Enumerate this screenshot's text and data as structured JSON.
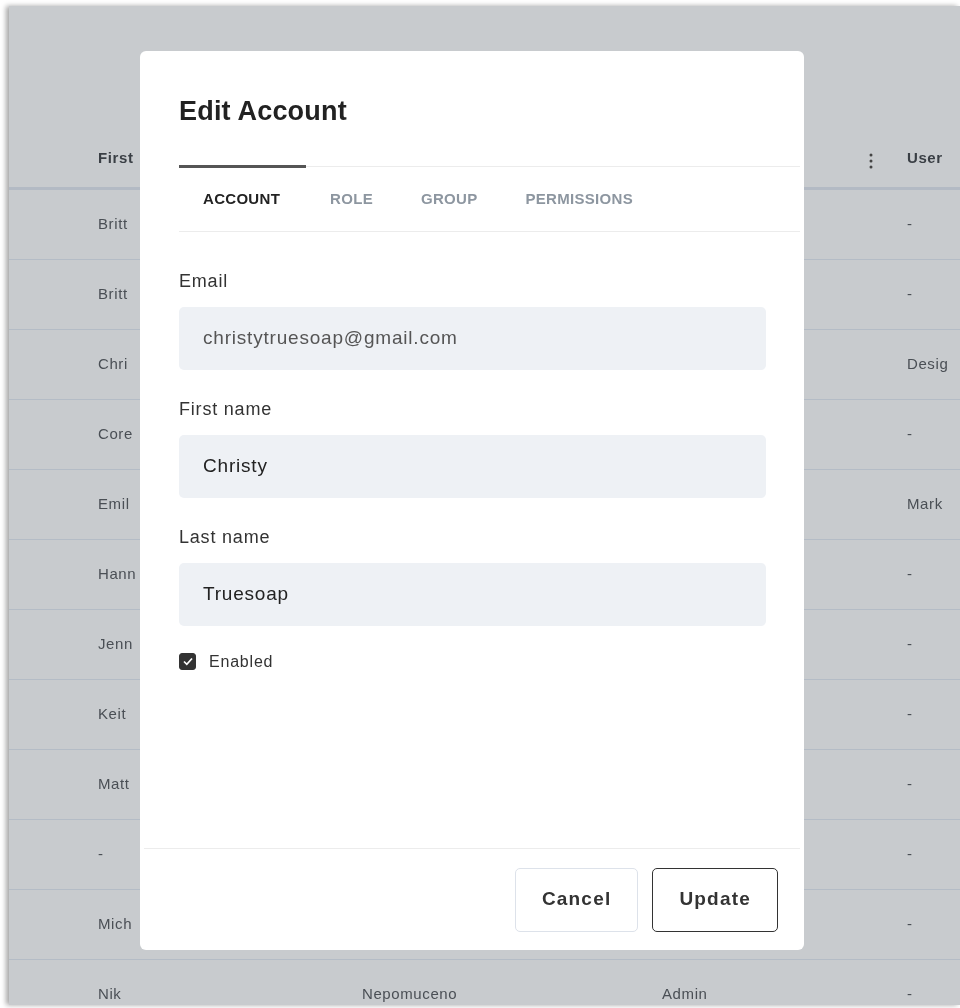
{
  "table": {
    "columns": [
      "First",
      "User"
    ],
    "rows": [
      {
        "first": "Britt",
        "user": "-"
      },
      {
        "first": "Britt",
        "user": "-"
      },
      {
        "first": "Chri",
        "user": "Desig"
      },
      {
        "first": "Core",
        "user": "-"
      },
      {
        "first": "Emil",
        "user": "Mark"
      },
      {
        "first": "Hann",
        "user": "-"
      },
      {
        "first": "Jenn",
        "user": "-"
      },
      {
        "first": "Keit",
        "user": "-"
      },
      {
        "first": "Matt",
        "user": "-"
      },
      {
        "first": "-",
        "user": "-"
      },
      {
        "first": "Mich",
        "user": "-"
      },
      {
        "first": "Nik",
        "column_2": "Nepomuceno",
        "column_3": "Admin",
        "user": "-"
      }
    ]
  },
  "dialog": {
    "title": "Edit Account",
    "tabs": [
      {
        "label": "ACCOUNT",
        "selected": true
      },
      {
        "label": "ROLE",
        "selected": false
      },
      {
        "label": "GROUP",
        "selected": false
      },
      {
        "label": "PERMISSIONS",
        "selected": false
      }
    ],
    "fields": [
      {
        "label": "Email",
        "value": "christytruesoap@gmail.com",
        "disabled": true
      },
      {
        "label": "First name",
        "value": "Christy",
        "disabled": false
      },
      {
        "label": "Last name",
        "value": "Truesoap",
        "disabled": false
      }
    ],
    "enabled": {
      "label": "Enabled",
      "checked": true
    },
    "buttons": [
      {
        "label": "Cancel",
        "kind": "secondary"
      },
      {
        "label": "Update",
        "kind": "primary"
      }
    ]
  }
}
